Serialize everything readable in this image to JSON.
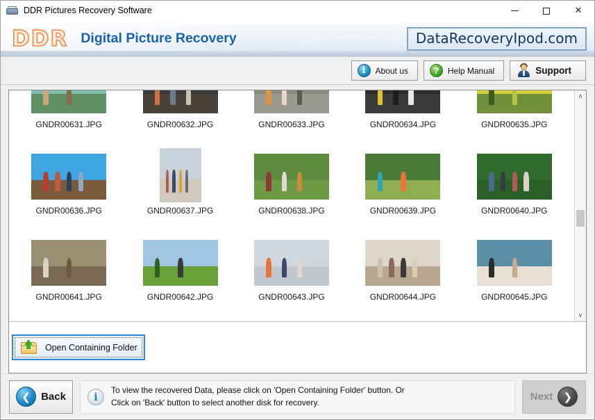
{
  "window": {
    "title": "DDR Pictures Recovery Software",
    "icon": "scanner-icon",
    "minimize_label": "–",
    "maximize_label": "□",
    "close_label": "✕"
  },
  "brand": {
    "logo_text": "DDR",
    "product_title": "Digital Picture Recovery",
    "site_url": "DataRecoveryIpod.com"
  },
  "toolbar": {
    "about_label": "About us",
    "about_icon": "info-icon",
    "help_label": "Help Manual",
    "help_icon": "question-mark-icon",
    "help_glyph": "?",
    "about_glyph": "i",
    "support_label": "Support",
    "support_icon": "support-person-icon"
  },
  "grid": {
    "files": [
      {
        "name": "GNDR00631.JPG",
        "orientation": "landscape",
        "sky": "#7fbfae",
        "ground": "#5f8f62",
        "figures": [
          "#caa87a",
          "#8a6a4a"
        ]
      },
      {
        "name": "GNDR00632.JPG",
        "orientation": "landscape",
        "sky": "#3a3a3a",
        "ground": "#4a4238",
        "figures": [
          "#d2703f",
          "#6d7a8c",
          "#c9c2b6"
        ]
      },
      {
        "name": "GNDR00633.JPG",
        "orientation": "landscape",
        "sky": "#8a8a80",
        "ground": "#9a9a90",
        "figures": [
          "#e09243",
          "#e8d9c6",
          "#5c5a55"
        ]
      },
      {
        "name": "GNDR00634.JPG",
        "orientation": "landscape",
        "sky": "#2e2e2e",
        "ground": "#3a3a3a",
        "figures": [
          "#e0c230",
          "#1d1d1d",
          "#e8e8e8"
        ]
      },
      {
        "name": "GNDR00635.JPG",
        "orientation": "landscape",
        "sky": "#d8d23a",
        "ground": "#6f8f3a",
        "figures": [
          "#3f5a22",
          "#b8c24a"
        ]
      },
      {
        "name": "GNDR00636.JPG",
        "orientation": "landscape",
        "sky": "#3fa5e0",
        "ground": "#7a5a3a",
        "figures": [
          "#b5402e",
          "#c05a3a",
          "#2b3f5e",
          "#8fa8c4"
        ]
      },
      {
        "name": "GNDR00637.JPG",
        "orientation": "portrait",
        "sky": "#c9d3dc",
        "ground": "#cfc8bd",
        "figures": [
          "#b05a4a",
          "#3a4a6a",
          "#d8a23a",
          "#6a6a6a"
        ]
      },
      {
        "name": "GNDR00638.JPG",
        "orientation": "landscape",
        "sky": "#5d8a3f",
        "ground": "#6f9a45",
        "figures": [
          "#8f3a3a",
          "#e0dcd0",
          "#c98a3a"
        ]
      },
      {
        "name": "GNDR00639.JPG",
        "orientation": "landscape",
        "sky": "#4a7a35",
        "ground": "#8fae52",
        "figures": [
          "#2aa8b8",
          "#e8743a"
        ]
      },
      {
        "name": "GNDR00640.JPG",
        "orientation": "landscape",
        "sky": "#2f6b2a",
        "ground": "#2a5f26",
        "figures": [
          "#4a6a8f",
          "#3a3a4a",
          "#b05a5a",
          "#d8d2c8"
        ]
      },
      {
        "name": "GNDR00641.JPG",
        "orientation": "landscape",
        "sky": "#9a8f72",
        "ground": "#7a6a52",
        "figures": [
          "#d8d2c2",
          "#6a5a42"
        ]
      },
      {
        "name": "GNDR00642.JPG",
        "orientation": "landscape",
        "sky": "#9fc6e2",
        "ground": "#6aa03a",
        "figures": [
          "#2f5f22",
          "#3a3a3a"
        ]
      },
      {
        "name": "GNDR00643.JPG",
        "orientation": "landscape",
        "sky": "#cfd8de",
        "ground": "#bfc8cf",
        "figures": [
          "#e8743a",
          "#3a4a6a",
          "#e0d8cc"
        ]
      },
      {
        "name": "GNDR00644.JPG",
        "orientation": "landscape",
        "sky": "#ded6c8",
        "ground": "#b8a88f",
        "figures": [
          "#c9c2b2",
          "#8a6a5a",
          "#3a3a3a",
          "#d8ccb8"
        ]
      },
      {
        "name": "GNDR00645.JPG",
        "orientation": "landscape",
        "sky": "#5a8fa8",
        "ground": "#e6e0d2",
        "figures": [
          "#2a2a2a",
          "#c9a88f"
        ]
      }
    ]
  },
  "scrollbar": {
    "up_glyph": "∧",
    "down_glyph": "∨",
    "thumb_position_pct": 52
  },
  "actions": {
    "open_folder_label": "Open Containing Folder",
    "open_folder_icon": "open-folder-upload-icon"
  },
  "footer": {
    "back_label": "Back",
    "back_icon": "chevron-left-icon",
    "back_glyph": "❮",
    "next_label": "Next",
    "next_icon": "chevron-right-icon",
    "next_glyph": "❯",
    "next_disabled": true,
    "info_icon": "info-icon",
    "info_glyph": "i",
    "info_line1": "To view the recovered Data, please click on 'Open Containing Folder' button. Or",
    "info_line2": "Click on 'Back' button to select another disk for recovery."
  },
  "colors": {
    "brand_blue": "#1862b0",
    "logo_orange": "#f2883c",
    "focus_blue": "#2b87d3",
    "accent_green": "#3ea32a"
  }
}
